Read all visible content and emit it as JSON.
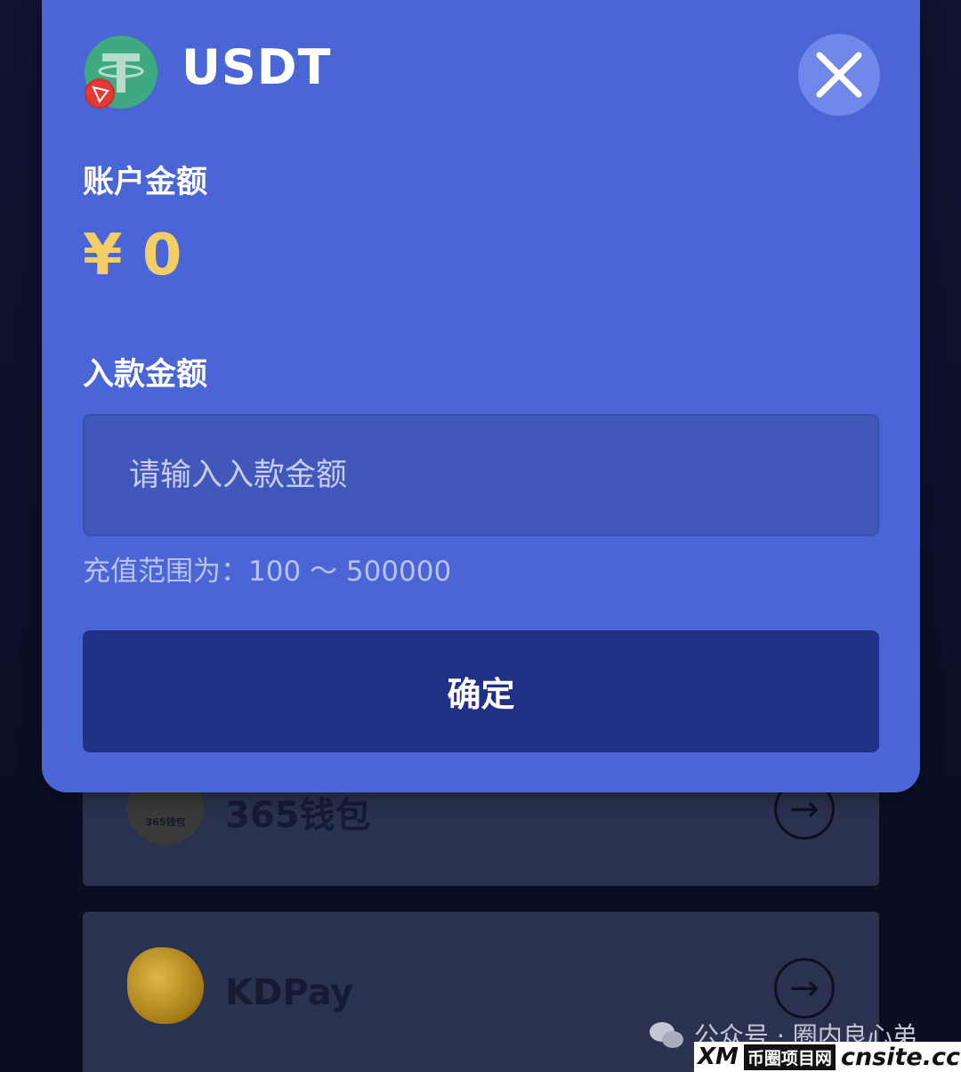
{
  "modal": {
    "coin_icon": "tether-usdt-icon",
    "network_badge_icon": "tron-icon",
    "title": "USDT",
    "close_icon": "close-icon",
    "balance_label": "账户金额",
    "balance_value": "¥ 0",
    "deposit_label": "入款金额",
    "deposit_input": {
      "value": "",
      "placeholder": "请输入入款金额"
    },
    "range_hint": "充值范围为：100 ～ 500000",
    "confirm_label": "确定"
  },
  "background_list": {
    "items": [
      {
        "name": "365钱包",
        "logo_text": "365钱包",
        "icon": "arrow-right-icon"
      },
      {
        "name": "KDPay",
        "icon": "arrow-right-icon"
      }
    ]
  },
  "watermark": {
    "text": "公众号 · 圈内良心弟",
    "brand": "XM",
    "site_name": "币圈项目网",
    "url": "cnsite.cc"
  },
  "colors": {
    "modal_bg": "#4a66d6",
    "accent_gold": "#f2cd68",
    "confirm_bg": "#203086",
    "input_bg": "#4157b9"
  }
}
